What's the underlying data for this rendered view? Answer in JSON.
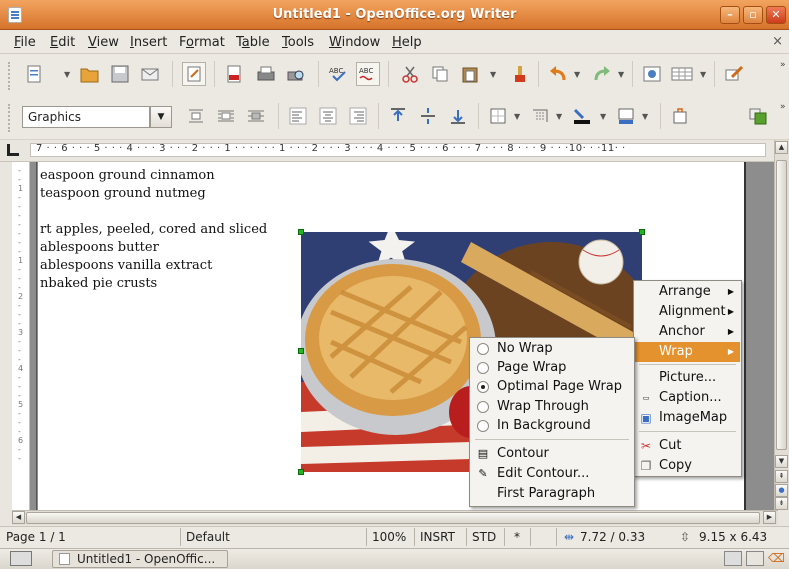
{
  "window": {
    "title": "Untitled1 - OpenOffice.org Writer",
    "buttons": {
      "minimize": "–",
      "maximize": "▫",
      "close": "✕"
    }
  },
  "menubar": {
    "items": [
      {
        "label": "File",
        "accel": "F",
        "rest": "ile"
      },
      {
        "label": "Edit",
        "accel": "E",
        "rest": "dit"
      },
      {
        "label": "View",
        "accel": "V",
        "rest": "iew"
      },
      {
        "label": "Insert",
        "accel": "I",
        "rest": "nsert"
      },
      {
        "label": "Format",
        "accel": "o"
      },
      {
        "label": "Table",
        "accel": "a"
      },
      {
        "label": "Tools",
        "accel": "T",
        "rest": "ools"
      },
      {
        "label": "Window",
        "accel": "W",
        "rest": "indow"
      },
      {
        "label": "Help",
        "accel": "H",
        "rest": "elp"
      }
    ],
    "close_glyph": "×"
  },
  "toolbar": {
    "style_value": "Graphics",
    "icons": [
      "new-icon",
      "open-icon",
      "save-icon",
      "email-icon",
      "edit-file-icon",
      "export-pdf-icon",
      "print-icon",
      "print-preview-icon",
      "spellcheck-icon",
      "autospell-icon",
      "cut-icon",
      "copy-icon",
      "paste-icon",
      "format-paintbrush-icon",
      "undo-icon",
      "redo-icon",
      "navigator-icon",
      "table-icon",
      "show-draw-functions-icon"
    ]
  },
  "ruler": {
    "text": "7 · · 6 · · · 5 · · · 4 · · · 3 · · · 2 · · · 1 · · ·   · · · 1 · · · 2 · · · 3 · · · 4 · · · 5 · · · 6 · · · 7 · · · 8 · · · 9 · · ·10· · ·11· ·"
  },
  "document": {
    "lines": [
      "easpoon ground cinnamon",
      " teaspoon ground nutmeg",
      "",
      "rt apples, peeled, cored and sliced",
      "ablespoons butter",
      "ablespoons vanilla extract",
      "nbaked pie crusts"
    ]
  },
  "context_menu": {
    "items": [
      {
        "label": "Arrange",
        "has_submenu": true
      },
      {
        "label": "Alignment",
        "has_submenu": true
      },
      {
        "label": "Anchor",
        "has_submenu": true
      },
      {
        "label": "Wrap",
        "has_submenu": true,
        "highlighted": true
      },
      {
        "label": "Picture..."
      },
      {
        "label": "Caption...",
        "icon": "caption-icon"
      },
      {
        "label": "ImageMap",
        "icon": "imagemap-icon"
      },
      {
        "label": "Cut",
        "icon": "cut-icon"
      },
      {
        "label": "Copy",
        "icon": "copy-icon"
      }
    ]
  },
  "wrap_submenu": {
    "items": [
      {
        "label": "No Wrap",
        "radio": true,
        "checked": false
      },
      {
        "label": "Page Wrap",
        "radio": true,
        "checked": false
      },
      {
        "label": "Optimal Page Wrap",
        "radio": true,
        "checked": true
      },
      {
        "label": "Wrap Through",
        "radio": true,
        "checked": false
      },
      {
        "label": "In Background",
        "radio": true,
        "checked": false
      },
      {
        "label": "Contour",
        "icon": "contour-icon"
      },
      {
        "label": "Edit Contour...",
        "icon": "edit-contour-icon"
      },
      {
        "label": "First Paragraph"
      }
    ]
  },
  "statusbar": {
    "page": "Page 1 / 1",
    "style": "Default",
    "zoom": "100%",
    "insert_mode": "INSRT",
    "selection_mode": "STD",
    "modified": "*",
    "position": "7.72 / 0.33",
    "size": "9.15 x 6.43"
  },
  "taskbar": {
    "task_label": "Untitled1 - OpenOffic..."
  },
  "colors": {
    "title_bar": "#d6732b",
    "menu_highlight": "#e4922e",
    "selection_handle": "#22b722"
  }
}
